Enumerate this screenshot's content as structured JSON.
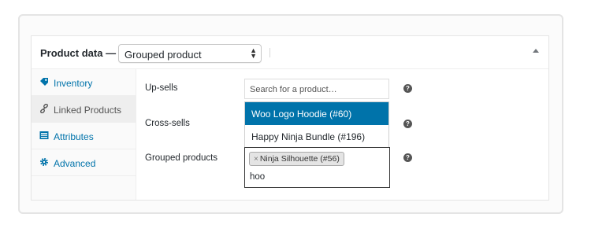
{
  "panel": {
    "title": "Product data —",
    "product_type": {
      "selected": "Grouped product"
    }
  },
  "tabs": [
    {
      "label": "Inventory",
      "icon": "inventory-icon",
      "active": false
    },
    {
      "label": "Linked Products",
      "icon": "link-icon",
      "active": true
    },
    {
      "label": "Attributes",
      "icon": "attributes-icon",
      "active": false
    },
    {
      "label": "Advanced",
      "icon": "gear-icon",
      "active": false
    }
  ],
  "fields": {
    "upsells": {
      "label": "Up-sells",
      "placeholder": "Search for a product…"
    },
    "crosssells": {
      "label": "Cross-sells"
    },
    "grouped": {
      "label": "Grouped products",
      "token": "Ninja Silhouette (#56)",
      "token_remove": "×",
      "search_value": "hoo"
    }
  },
  "dropdown": {
    "options": [
      {
        "label": "Woo Logo Hoodie (#60)",
        "highlighted": true
      },
      {
        "label": "Happy Ninja Bundle (#196)",
        "highlighted": false
      }
    ]
  },
  "help_glyph": "?",
  "colors": {
    "accent": "#0073aa",
    "text": "#23282d"
  }
}
